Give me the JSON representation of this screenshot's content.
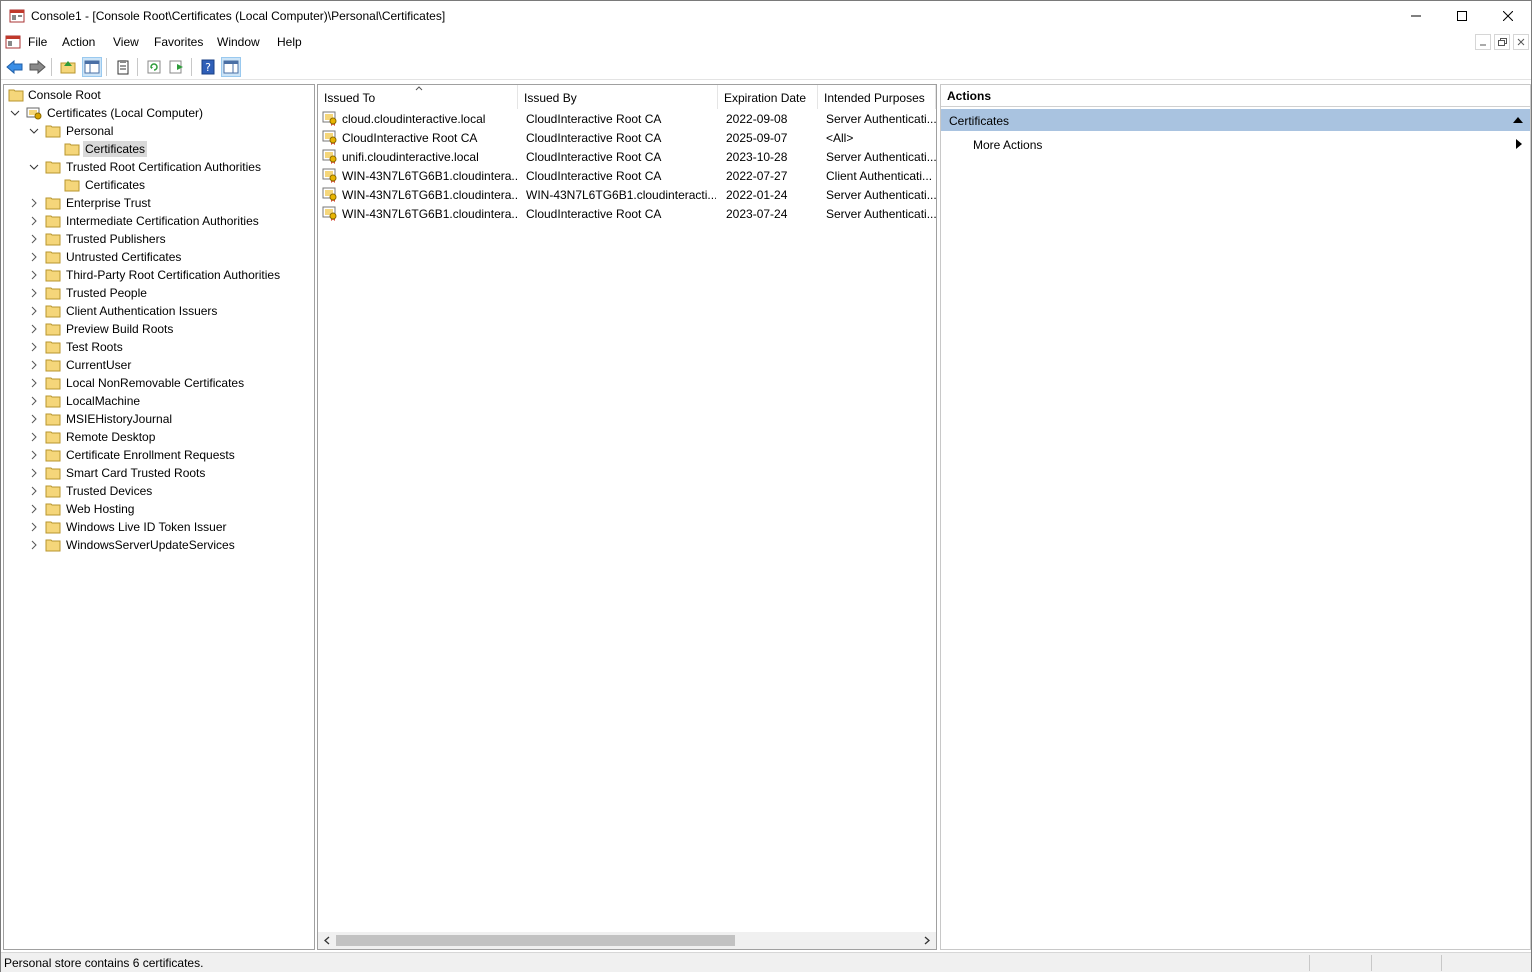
{
  "window": {
    "title": "Console1 - [Console Root\\Certificates (Local Computer)\\Personal\\Certificates]"
  },
  "menu": [
    "File",
    "Action",
    "View",
    "Favorites",
    "Window",
    "Help"
  ],
  "toolbar": {
    "buttons": [
      "back-icon",
      "forward-icon",
      "up-folder-icon",
      "show-hide-tree-icon",
      "properties-icon",
      "refresh-icon",
      "export-list-icon",
      "help-icon",
      "show-hide-action-pane-icon"
    ]
  },
  "tree": {
    "root": "Console Root",
    "computer": "Certificates (Local Computer)",
    "personal": "Personal",
    "personal_certs": "Certificates",
    "trusted_root": "Trusted Root Certification Authorities",
    "trusted_root_certs": "Certificates",
    "stores": [
      "Enterprise Trust",
      "Intermediate Certification Authorities",
      "Trusted Publishers",
      "Untrusted Certificates",
      "Third-Party Root Certification Authorities",
      "Trusted People",
      "Client Authentication Issuers",
      "Preview Build Roots",
      "Test Roots",
      "CurrentUser",
      "Local NonRemovable Certificates",
      "LocalMachine",
      "MSIEHistoryJournal",
      "Remote Desktop",
      "Certificate Enrollment Requests",
      "Smart Card Trusted Roots",
      "Trusted Devices",
      "Web Hosting",
      "Windows Live ID Token Issuer",
      "WindowsServerUpdateServices"
    ]
  },
  "list": {
    "columns": [
      "Issued To",
      "Issued By",
      "Expiration Date",
      "Intended Purposes"
    ],
    "rows": [
      [
        "cloud.cloudinteractive.local",
        "CloudInteractive Root CA",
        "2022-09-08",
        "Server Authenticati..."
      ],
      [
        "CloudInteractive Root CA",
        "CloudInteractive Root CA",
        "2025-09-07",
        "<All>"
      ],
      [
        "unifi.cloudinteractive.local",
        "CloudInteractive Root CA",
        "2023-10-28",
        "Server Authenticati..."
      ],
      [
        "WIN-43N7L6TG6B1.cloudintera...",
        "CloudInteractive Root CA",
        "2022-07-27",
        "Client Authenticati..."
      ],
      [
        "WIN-43N7L6TG6B1.cloudintera...",
        "WIN-43N7L6TG6B1.cloudinteracti...",
        "2022-01-24",
        "Server Authenticati..."
      ],
      [
        "WIN-43N7L6TG6B1.cloudintera...",
        "CloudInteractive Root CA",
        "2023-07-24",
        "Server Authenticati..."
      ]
    ]
  },
  "actions": {
    "header": "Actions",
    "section": "Certificates",
    "items": [
      "More Actions"
    ]
  },
  "status": "Personal store contains 6 certificates.",
  "colors": {
    "selection": "#d9d9d9",
    "action_section": "#a9c3e0",
    "folder": "#f5d67a"
  }
}
